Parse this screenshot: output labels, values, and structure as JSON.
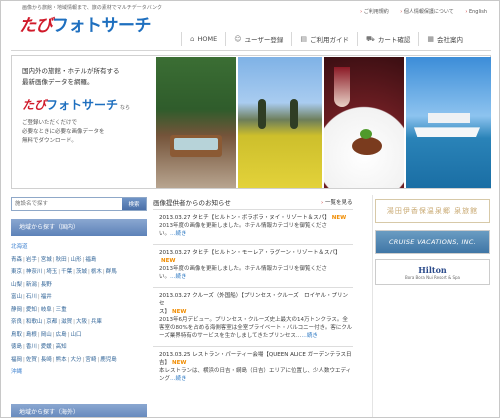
{
  "header": {
    "tagline": "画像から旅館・地域情報まで、旅の素材でマルチデータバンク",
    "logo_part1": "たび",
    "logo_part2": "フォトサーチ",
    "top_links": [
      "ご利用規約",
      "個人情報保護について",
      "English"
    ],
    "nav": [
      {
        "icon": "home-icon",
        "glyph": "⌂",
        "label": "HOME"
      },
      {
        "icon": "user-register-icon",
        "glyph": "☺",
        "label": "ユーザー登録"
      },
      {
        "icon": "guide-icon",
        "glyph": "▤",
        "label": "ご利用ガイド"
      },
      {
        "icon": "cart-icon",
        "glyph": "⛟",
        "label": "カート確認"
      },
      {
        "icon": "company-icon",
        "glyph": "▦",
        "label": "会社案内"
      }
    ]
  },
  "hero": {
    "headline": "国内外の旅館・ホテルが所有する\n最新画像データを網羅。",
    "logo_part1": "たび",
    "logo_part2": "フォトサーチ",
    "logo_suffix": "なら",
    "description": "ご登録いただくだけで\n必要なときに必要な画像データを\n無料でダウンロード。"
  },
  "search": {
    "placeholder": "施設名で探す",
    "button_label": "検索"
  },
  "area": {
    "header": "地域から探す（国内）",
    "rows": [
      {
        "type": "region",
        "items": [
          "北海道"
        ]
      },
      {
        "type": "pref",
        "items": [
          "青森",
          "岩手",
          "宮城",
          "秋田",
          "山形",
          "福島"
        ]
      },
      {
        "type": "pref",
        "items": [
          "東京",
          "神奈川",
          "埼玉",
          "千葉",
          "茨城",
          "栃木",
          "群馬"
        ]
      },
      {
        "type": "pref",
        "items": [
          "山梨",
          "新潟",
          "長野"
        ]
      },
      {
        "type": "pref",
        "items": [
          "富山",
          "石川",
          "福井"
        ]
      },
      {
        "type": "pref",
        "items": [
          "静岡",
          "愛知",
          "岐阜",
          "三重"
        ]
      },
      {
        "type": "pref",
        "items": [
          "奈良",
          "和歌山",
          "京都",
          "滋賀",
          "大阪",
          "兵庫"
        ]
      },
      {
        "type": "pref",
        "items": [
          "鳥取",
          "島根",
          "岡山",
          "広島",
          "山口"
        ]
      },
      {
        "type": "pref",
        "items": [
          "徳島",
          "香川",
          "愛媛",
          "高知"
        ]
      },
      {
        "type": "pref",
        "items": [
          "福岡",
          "佐賀",
          "長崎",
          "熊本",
          "大分",
          "宮崎",
          "鹿児島"
        ]
      },
      {
        "type": "region",
        "items": [
          "沖縄"
        ]
      }
    ],
    "abroad_header": "地域から探す（海外）"
  },
  "news": {
    "title": "画像提供者からのお知らせ",
    "more_label": "一覧を見る",
    "new_label": "NEW",
    "continue_label": "…続き",
    "items": [
      {
        "head": "2013.03.27 タヒチ【ヒルトン・ボラボラ・ヌイ・リゾート＆スパ】",
        "body": "2013年度の画像を更新しました。ホテル情報カテゴリを御覧くださ\nい。"
      },
      {
        "head": "2013.03.27 タヒチ【ヒルトン・モーレア・ラグーン・リゾート＆スパ】",
        "body": "2013年度の画像を更新しました。ホテル情報カテゴリを御覧くださ\nい。"
      },
      {
        "head": "2013.03.27 クルーズ（外国船）【プリンセス・クルーズ　ロイヤル・プリンセ\nス】",
        "body": "2013年6月デビュー。プリンセス・クルーズ史上最大の14万トンクラス。全\n客室の80%を占める海側客室は全室プライベート・バルコニー付き。客にクル\nーズ業界特有のサービスを生かしましてきたプリンセス…"
      },
      {
        "head": "2013.03.25 レストラン・パーティー会場【QUEEN ALICE ガーデンテラス日\n吉】",
        "body": "本レストランは、横浜の日吉・綱島（日吉）エリアに位置し、少人数ウエディング"
      }
    ]
  },
  "banners": {
    "banner1": "湯田伊香保温泉郷 泉旅館",
    "banner2": "CRUISE VACATIONS, INC.",
    "banner3_logo": "Hilton",
    "banner3_sub": "Bora Bora Nui Resort & Spa"
  },
  "colors": {
    "logo_red": "#d01a2a",
    "logo_blue": "#1e6fbf",
    "link_blue": "#336699",
    "side_header_blue": "#5d82b8",
    "new_orange": "#f08c00"
  }
}
